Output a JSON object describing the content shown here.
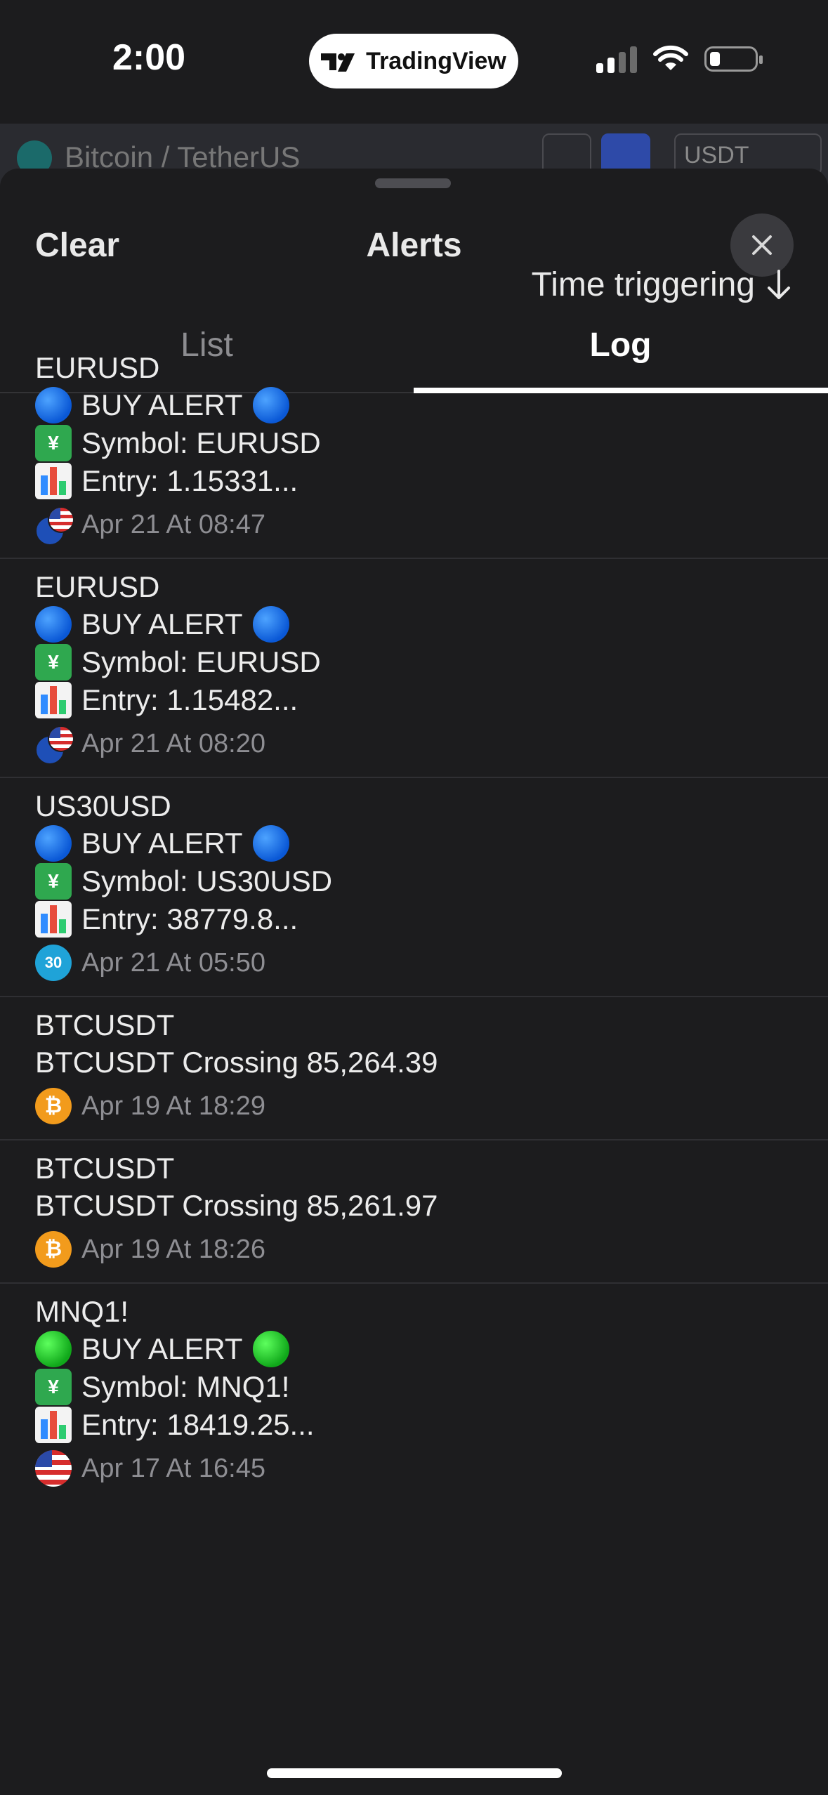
{
  "status_bar": {
    "time": "2:00",
    "app_pill": "TradingView"
  },
  "background": {
    "symbol_title": "Bitcoin / TetherUS",
    "currency": "USDT"
  },
  "sheet": {
    "clear_label": "Clear",
    "title": "Alerts",
    "tabs": [
      {
        "label": "List",
        "active": false
      },
      {
        "label": "Log",
        "active": true
      }
    ],
    "sort_label": "Time triggering"
  },
  "log": [
    {
      "symbol": "EURUSD",
      "lines": [
        "BUY ALERT",
        "Symbol: EURUSD",
        "Entry:  1.15331..."
      ],
      "time": "Apr 21 At 08:47",
      "icon": "eurusd-flags-icon",
      "alert_dot_color": "#0a58d6"
    },
    {
      "symbol": "EURUSD",
      "lines": [
        "BUY ALERT",
        "Symbol: EURUSD",
        "Entry:  1.15482..."
      ],
      "time": "Apr 21 At 08:20",
      "icon": "eurusd-flags-icon",
      "alert_dot_color": "#0a58d6"
    },
    {
      "symbol": "US30USD",
      "lines": [
        "BUY ALERT",
        "Symbol: US30USD",
        "Entry:  38779.8..."
      ],
      "time": "Apr 21 At 05:50",
      "icon": "us30-badge-icon",
      "icon_text": "30",
      "alert_dot_color": "#0a58d6"
    },
    {
      "symbol": "BTCUSDT",
      "lines": [
        "BTCUSDT Crossing 85,264.39"
      ],
      "time": "Apr 19 At 18:29",
      "icon": "bitcoin-icon"
    },
    {
      "symbol": "BTCUSDT",
      "lines": [
        "BTCUSDT Crossing 85,261.97"
      ],
      "time": "Apr 19 At 18:26",
      "icon": "bitcoin-icon"
    },
    {
      "symbol": "MNQ1!",
      "lines": [
        "BUY ALERT",
        "Symbol: MNQ1!",
        "Entry: 18419.25..."
      ],
      "time": "Apr 17 At 16:45",
      "icon": "us-flag-icon",
      "alert_dot_color": "#10a81a"
    }
  ]
}
